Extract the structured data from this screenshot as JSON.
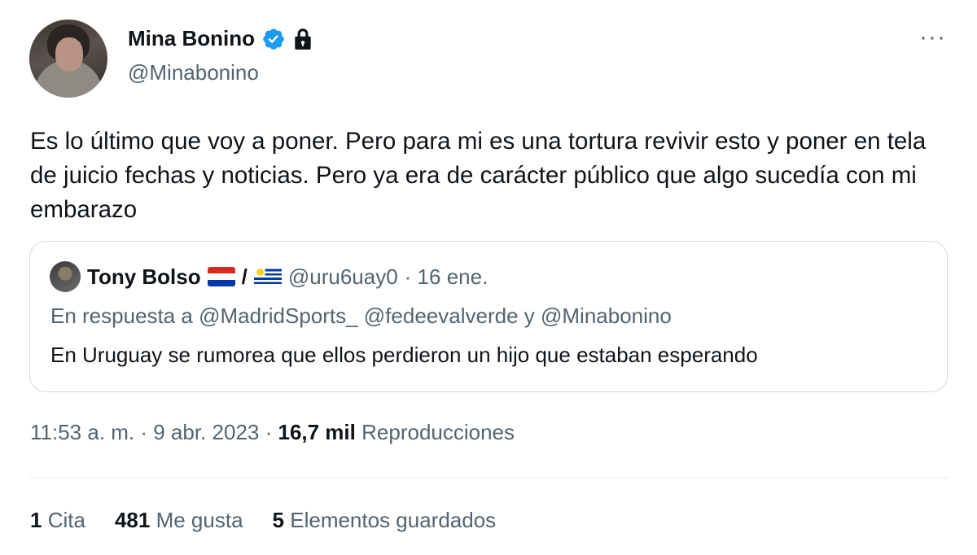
{
  "author": {
    "name": "Mina Bonino",
    "handle": "@Minabonino",
    "verified_icon": "verified-badge-icon",
    "lock_icon": "lock-icon"
  },
  "more_icon": "more-options-icon",
  "tweet": {
    "text": "Es lo último que voy a poner. Pero para mi es una tortura revivir esto y poner en tela de juicio fechas y noticias. Pero ya era de carácter público que algo sucedía con mi embarazo"
  },
  "quoted": {
    "name": "Tony Bolso",
    "separator": "/",
    "handle": "@uru6uay0",
    "date": "· 16 ene.",
    "reply_to": "En respuesta a @MadridSports_ @fedeevalverde y @Minabonino",
    "text": "En Uruguay se rumorea que ellos perdieron un hijo que estaban esperando"
  },
  "meta": {
    "time": "11:53 a. m. · 9 abr. 2023 · ",
    "views_count": "16,7 mil",
    "views_label": "Reproducciones"
  },
  "stats": {
    "quotes_count": "1",
    "quotes_label": "Cita",
    "likes_count": "481",
    "likes_label": "Me gusta",
    "bookmarks_count": "5",
    "bookmarks_label": "Elementos guardados"
  },
  "colors": {
    "verified": "#1d9bf0",
    "secondary_text": "#536471",
    "primary_text": "#0f1419",
    "border": "#cfd9de"
  }
}
